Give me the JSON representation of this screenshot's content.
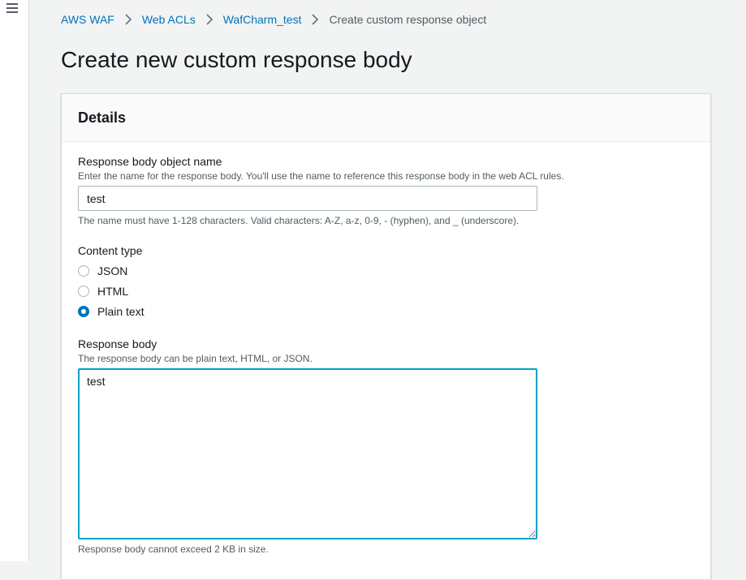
{
  "nav": {
    "menu_icon": "hamburger-menu-icon"
  },
  "breadcrumb": {
    "items": [
      "AWS WAF",
      "Web ACLs",
      "WafCharm_test"
    ],
    "current": "Create custom response object",
    "separator_icon": "chevron-right-icon"
  },
  "page": {
    "title": "Create new custom response body"
  },
  "details": {
    "title": "Details",
    "name_field": {
      "label": "Response body object name",
      "description": "Enter the name for the response body. You'll use the name to reference this response body in the web ACL rules.",
      "value": "test",
      "constraint": "The name must have 1-128 characters. Valid characters: A-Z, a-z, 0-9, - (hyphen), and _ (underscore)."
    },
    "content_type": {
      "label": "Content type",
      "options": [
        "JSON",
        "HTML",
        "Plain text"
      ],
      "selected": "Plain text"
    },
    "body_field": {
      "label": "Response body",
      "description": "The response body can be plain text, HTML, or JSON.",
      "value": "test",
      "constraint": "Response body cannot exceed 2 KB in size."
    }
  },
  "colors": {
    "link": "#0073bb",
    "focus": "#00a1c9",
    "radio_selected": "#0073bb",
    "background": "#f2f3f3"
  }
}
